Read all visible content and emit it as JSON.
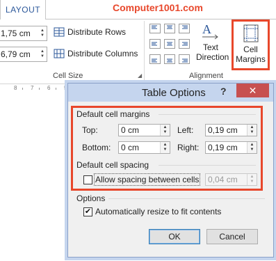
{
  "tabs": {
    "layout_label": "LAYOUT"
  },
  "watermark": "Computer1001.com",
  "cell_size": {
    "height_value": "1,75 cm",
    "width_value": "6,79 cm",
    "distribute_rows": "Distribute Rows",
    "distribute_columns": "Distribute Columns",
    "group_label": "Cell Size"
  },
  "alignment": {
    "text_direction_line1": "Text",
    "text_direction_line2": "Direction",
    "cell_margins_line1": "Cell",
    "cell_margins_line2": "Margins",
    "group_label": "Alignment"
  },
  "ruler": {
    "numbers": [
      "8",
      "7",
      "6",
      "5",
      "4",
      "3",
      "2",
      "1"
    ]
  },
  "dialog": {
    "title": "Table Options",
    "help": "?",
    "close": "✕",
    "default_cell_margins": "Default cell margins",
    "top_label": "Top:",
    "top_value": "0 cm",
    "bottom_label": "Bottom:",
    "bottom_value": "0 cm",
    "left_label": "Left:",
    "left_value": "0,19 cm",
    "right_label": "Right:",
    "right_value": "0,19 cm",
    "default_cell_spacing": "Default cell spacing",
    "allow_spacing_label": "Allow spacing between cells",
    "allow_spacing_checked": false,
    "spacing_value": "0,04 cm",
    "options_label": "Options",
    "auto_resize_label": "Automatically resize to fit contents",
    "auto_resize_checked": true,
    "ok": "OK",
    "cancel": "Cancel"
  },
  "colors": {
    "accent_red": "#e8472b",
    "tab_blue": "#2b579a",
    "titlebar": "#c5d5ee",
    "close_red": "#c75050"
  }
}
